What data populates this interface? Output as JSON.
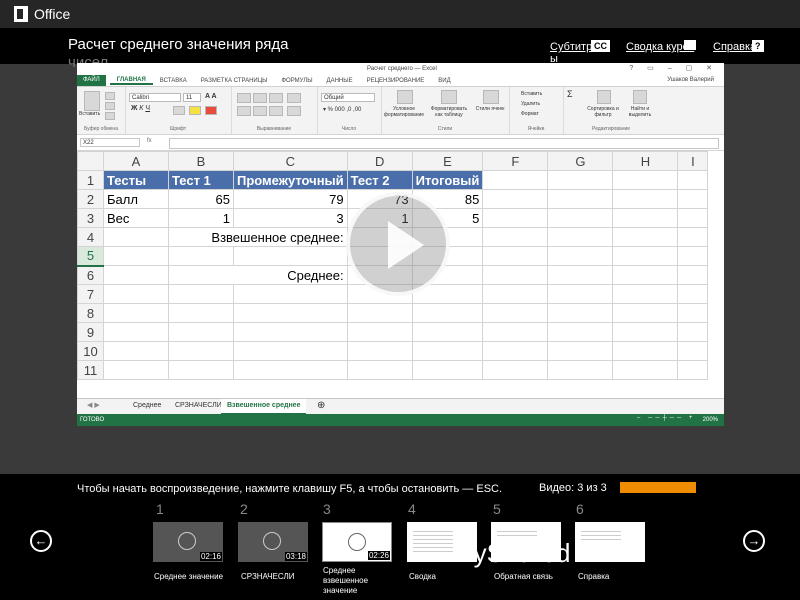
{
  "top": {
    "app_name": "Office"
  },
  "header": {
    "title": "Расчет среднего значения ряда",
    "title_overflow": "чисел",
    "subtitles_label": "Субтитр",
    "subtitles_label_2": "ы",
    "cc_badge": "CC",
    "course_summary_label": "Сводка курса",
    "help_label": "Справка",
    "help_badge": "?"
  },
  "excel": {
    "window_title": "Расчет среднего — Excel",
    "window_controls": "? ▭ – ▢ ✕",
    "file_tab": "ФАЙЛ",
    "tabs": [
      "ГЛАВНАЯ",
      "ВСТАВКА",
      "РАЗМЕТКА СТРАНИЦЫ",
      "ФОРМУЛЫ",
      "ДАННЫЕ",
      "РЕЦЕНЗИРОВАНИЕ",
      "ВИД"
    ],
    "user": "Ушаков Валерий",
    "ribbon": {
      "paste": "Вставить",
      "clipboard": "Буфер обмена",
      "font_name": "Calibri",
      "font_size": "11",
      "font_group": "Шрифт",
      "alignment_group": "Выравнивание",
      "number_format": "Общий",
      "number_group": "Число",
      "conditional": "Условное форматирование",
      "format_table": "Форматировать как таблицу",
      "cell_styles": "Стили ячеек",
      "styles_group": "Стили",
      "insert": "Вставить",
      "delete": "Удалить",
      "format": "Формат",
      "cells_group": "Ячейки",
      "sort": "Сортировка и фильтр",
      "find": "Найти и выделить",
      "editing_group": "Редактирование"
    },
    "name_box": "X22",
    "fx": "fx",
    "columns": [
      "A",
      "B",
      "C",
      "D",
      "E",
      "F",
      "G",
      "H",
      "I"
    ],
    "rows": [
      [
        "Тесты",
        "Тест 1",
        "Промежуточный",
        "Тест 2",
        "Итоговый",
        "",
        "",
        "",
        ""
      ],
      [
        "Балл",
        "65",
        "79",
        "73",
        "85",
        "",
        "",
        "",
        ""
      ],
      [
        "Вес",
        "1",
        "3",
        "1",
        "5",
        "",
        "",
        "",
        ""
      ],
      [
        "",
        "Взвешенное среднее:",
        "",
        "",
        "",
        "",
        "",
        "",
        ""
      ],
      [
        "",
        "",
        "",
        "",
        "",
        "",
        "",
        "",
        ""
      ],
      [
        "",
        "Среднее:",
        "",
        "",
        "",
        "",
        "",
        "",
        ""
      ],
      [
        "",
        "",
        "",
        "",
        "",
        "",
        "",
        "",
        ""
      ],
      [
        "",
        "",
        "",
        "",
        "",
        "",
        "",
        "",
        ""
      ],
      [
        "",
        "",
        "",
        "",
        "",
        "",
        "",
        "",
        ""
      ],
      [
        "",
        "",
        "",
        "",
        "",
        "",
        "",
        "",
        ""
      ],
      [
        "",
        "",
        "",
        "",
        "",
        "",
        "",
        "",
        ""
      ]
    ],
    "row_numbers": [
      "1",
      "2",
      "3",
      "4",
      "5",
      "6",
      "7",
      "8",
      "9",
      "10",
      "11"
    ],
    "sheets": [
      "Среднее",
      "СРЗНАЧЕСЛИ",
      "Взвешенное среднее"
    ],
    "status": "ГОТОВО",
    "zoom": "200%"
  },
  "footer": {
    "instructions": "Чтобы начать воспроизведение, нажмите клавишу F5, а чтобы остановить — ESC.",
    "video_count": "Видео: 3 из 3",
    "thumbs": [
      {
        "num": "1",
        "duration": "02:16",
        "label": "Среднее значение"
      },
      {
        "num": "2",
        "duration": "03:18",
        "label": "СРЗНАЧЕСЛИ"
      },
      {
        "num": "3",
        "duration": "02:26",
        "label": "Среднее взвешенное значение"
      },
      {
        "num": "4",
        "duration": "",
        "label": "Сводка"
      },
      {
        "num": "5",
        "duration": "",
        "label": "Обратная связь"
      },
      {
        "num": "6",
        "duration": "",
        "label": "Справка"
      }
    ],
    "brand": "MyShared"
  },
  "colors": {
    "excel_green": "#217346",
    "table_header": "#4a6ea9",
    "progress": "#f08c00"
  }
}
